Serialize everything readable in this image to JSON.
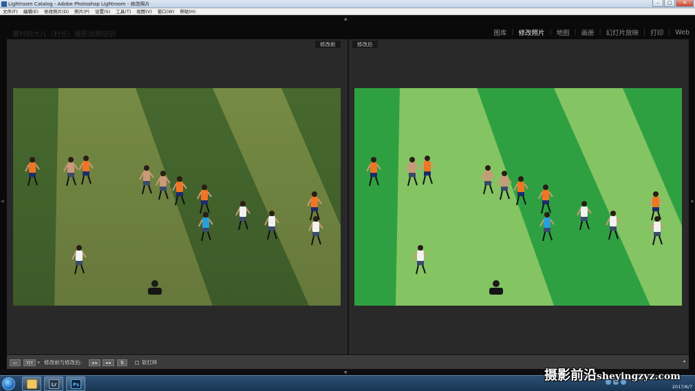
{
  "window": {
    "title": "Lightroom Catalog - Adobe Photoshop Lightroom - 修改照片",
    "controls": {
      "minimize": "–",
      "maximize": "□",
      "close": "✕"
    }
  },
  "menu": [
    "文件(F)",
    "编辑(E)",
    "修改照片(D)",
    "照片(P)",
    "设置(S)",
    "工具(T)",
    "视图(V)",
    "窗口(W)",
    "帮助(H)"
  ],
  "identity_plate": "寨村的大儿（村长）摄影后期培训",
  "modules": [
    {
      "label": "图库",
      "active": false
    },
    {
      "label": "修改照片",
      "active": true
    },
    {
      "label": "地图",
      "active": false
    },
    {
      "label": "画册",
      "active": false
    },
    {
      "label": "幻灯片放映",
      "active": false
    },
    {
      "label": "打印",
      "active": false
    },
    {
      "label": "Web",
      "active": false
    }
  ],
  "compare": {
    "before_label": "修改前",
    "after_label": "修改后"
  },
  "toolbar": {
    "view_label": "修改前与修改后:",
    "softproof_label": "软打样",
    "yy_label": "Y|Y",
    "copy_before_to_after": "◂ ▸",
    "copy_after_to_before": "◂ ▸",
    "swap": "⇅",
    "menu_arrow": "▾"
  },
  "colors": {
    "before_dark": "#4a6e31",
    "before_light": "#7c9248",
    "after_dark": "#2fa042",
    "after_light": "#84c463",
    "jersey": "#f07524",
    "accent": "#e8e8e8"
  },
  "taskbar": {
    "apps": [
      {
        "name": "folder",
        "label": ""
      },
      {
        "name": "lightroom",
        "label": "Lr"
      },
      {
        "name": "photoshop",
        "label": "Ps"
      }
    ],
    "date": "2017/6/7"
  },
  "watermark": {
    "text": "摄影前沿",
    "domain": "sheyingzyz.com"
  }
}
